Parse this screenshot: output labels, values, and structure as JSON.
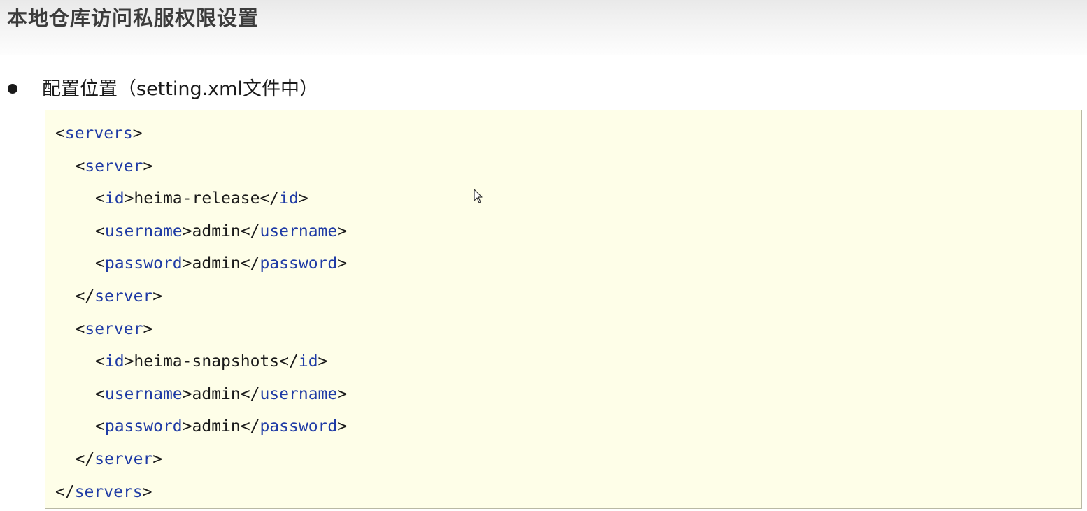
{
  "slide": {
    "title": "本地仓库访问私服权限设置",
    "bullet_text": "配置位置（setting.xml文件中）"
  },
  "code": {
    "lines": [
      {
        "indent": 0,
        "open": "servers",
        "value": "",
        "close": ""
      },
      {
        "indent": 1,
        "open": "server",
        "value": "",
        "close": ""
      },
      {
        "indent": 2,
        "open": "id",
        "value": "heima-release",
        "close": "id"
      },
      {
        "indent": 2,
        "open": "username",
        "value": "admin",
        "close": "username"
      },
      {
        "indent": 2,
        "open": "password",
        "value": "admin",
        "close": "password"
      },
      {
        "indent": 1,
        "open": "",
        "value": "",
        "close": "server"
      },
      {
        "indent": 1,
        "open": "server",
        "value": "",
        "close": ""
      },
      {
        "indent": 2,
        "open": "id",
        "value": "heima-snapshots",
        "close": "id"
      },
      {
        "indent": 2,
        "open": "username",
        "value": "admin",
        "close": "username"
      },
      {
        "indent": 2,
        "open": "password",
        "value": "admin",
        "close": "password"
      },
      {
        "indent": 1,
        "open": "",
        "value": "",
        "close": "server"
      },
      {
        "indent": 0,
        "open": "",
        "value": "",
        "close": "servers"
      }
    ]
  },
  "colors": {
    "tag": "#1f3ba5",
    "text": "#1a1a1a",
    "code_background": "#fefee8",
    "code_border": "#b9b9a4"
  },
  "icons": {
    "bullet": "filled-circle",
    "cursor": "mouse-pointer-icon"
  }
}
